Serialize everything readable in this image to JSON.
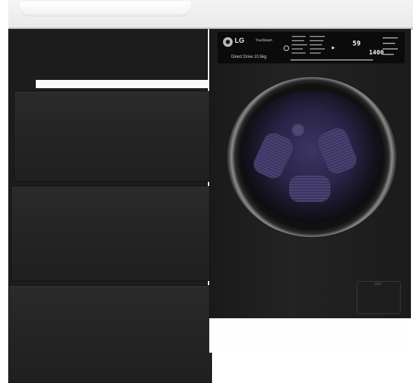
{
  "product": {
    "brand": "LG",
    "tech_label": "TrueSteam",
    "drive_label": "Direct Drive 10.5kg",
    "display_top": "59",
    "display_bottom": "1400"
  },
  "colors": {
    "counter": "#efefef",
    "cabinet": "#1f1f1f",
    "door_glass": "#2a2448",
    "door_trim": "#8b8b8b"
  }
}
